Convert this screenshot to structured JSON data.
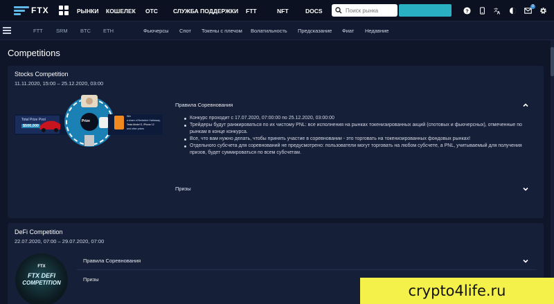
{
  "header": {
    "logo_text": "FTX",
    "nav": [
      "РЫНКИ",
      "КОШЕЛЕК",
      "OTC",
      "СЛУЖБА ПОДДЕРЖКИ",
      "FTT",
      "NFT",
      "DOCS"
    ],
    "search_placeholder": "Поиск рынка",
    "notification_count": "0",
    "accent_color": "#5fb8e8"
  },
  "subnav": {
    "coins": [
      "FTT",
      "SRM",
      "BTC",
      "ETH"
    ],
    "links": [
      "Фьючерсы",
      "Спот",
      "Токены с плечом",
      "Волатильность",
      "Предсказание",
      "Фиат",
      "Недавние"
    ]
  },
  "page": {
    "title": "Competitions"
  },
  "competitions": [
    {
      "title": "Stocks Competition",
      "dates": "11.11.2020, 15:00 – 25.12.2020, 03:00",
      "banner": {
        "pool_label": "Total Prize Pool",
        "pool_value": "$500,000",
        "center_label": "Prize",
        "side_text_1": "Win",
        "side_text_2": "a share of Berkshire Hathaway,",
        "side_text_3": "Tesla Model S, iPhone 12",
        "side_text_4": "and other prizes"
      },
      "rules_title": "Правила Соревнования",
      "rules": [
        "Конкурс проходит с 17.07.2020, 07:00:00 по 25.12.2020, 03:00:00",
        "Трейдеры будут ранжироваться по их чистому PNL: все исполнения на рынках токенизированных акций (спотовых и фьючерсных), отмеченные по рынкам в конце конкурса.",
        "Все, что вам нужно делать, чтобы принять участие в соревновании - это торговать на токенизированных фондовых рынках!",
        "Отдельного субсчета для соревнований не предусмотрено: пользователи могут торговать на любом субсчете, а PNL, учитываемый для получения призов, будет суммироваться по всем субсчетам."
      ],
      "prizes_title": "Призы"
    },
    {
      "title": "DeFi Competition",
      "dates": "22.07.2020, 07:00 – 29.07.2020, 07:00",
      "banner": {
        "logo": "FTX",
        "line1": "FTX DEFI",
        "line2": "COMPETITION"
      },
      "rules_title": "Правила Соревнования",
      "prizes_title": "Призы"
    }
  ],
  "watermark": "crypto4life.ru"
}
